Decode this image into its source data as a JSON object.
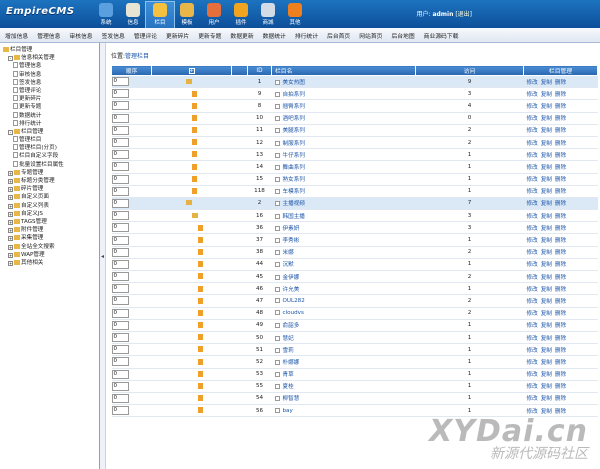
{
  "header": {
    "logo": "EmpireCMS",
    "nav": [
      {
        "label": "系统",
        "icon": "system-icon",
        "color": "#5aa0e0"
      },
      {
        "label": "信息",
        "icon": "info-icon",
        "color": "#e8e4d4"
      },
      {
        "label": "栏目",
        "icon": "column-icon",
        "color": "#f3c040",
        "active": true
      },
      {
        "label": "模板",
        "icon": "template-icon",
        "color": "#e9b64a"
      },
      {
        "label": "用户",
        "icon": "user-icon",
        "color": "#e66f3c"
      },
      {
        "label": "插件",
        "icon": "plugin-icon",
        "color": "#f0a41f"
      },
      {
        "label": "商城",
        "icon": "shop-icon",
        "color": "#d3dbe6"
      },
      {
        "label": "其他",
        "icon": "other-icon",
        "color": "#f07f1e"
      }
    ],
    "user_prefix": "用户:",
    "user_name": "admin",
    "logout": "[退出]"
  },
  "subnav": [
    "增加信息",
    "管理信息",
    "审核信息",
    "签发信息",
    "管理评论",
    "更新碎片",
    "更新专题",
    "数据更新",
    "数据统计",
    "排行统计",
    "后台首页",
    "网站首页",
    "后台地图",
    "商业源码下载"
  ],
  "tree": [
    {
      "lv": 0,
      "k": "fd",
      "t": "栏目管理"
    },
    {
      "lv": 1,
      "k": "fd",
      "t": "信息相关管理",
      "exp": "-"
    },
    {
      "lv": 2,
      "k": "doc",
      "t": "管理信息"
    },
    {
      "lv": 2,
      "k": "doc",
      "t": "审核信息"
    },
    {
      "lv": 2,
      "k": "doc",
      "t": "签发信息"
    },
    {
      "lv": 2,
      "k": "doc",
      "t": "管理评论"
    },
    {
      "lv": 2,
      "k": "doc",
      "t": "更新碎片"
    },
    {
      "lv": 2,
      "k": "doc",
      "t": "更新专题"
    },
    {
      "lv": 2,
      "k": "doc",
      "t": "数据统计"
    },
    {
      "lv": 2,
      "k": "doc",
      "t": "排行统计"
    },
    {
      "lv": 1,
      "k": "fd",
      "t": "栏目管理",
      "exp": "-"
    },
    {
      "lv": 2,
      "k": "doc",
      "t": "管理栏目"
    },
    {
      "lv": 2,
      "k": "doc",
      "t": "管理栏目(分页)"
    },
    {
      "lv": 2,
      "k": "doc",
      "t": "栏目自定义字段"
    },
    {
      "lv": 2,
      "k": "doc",
      "t": "批量设置栏目属性"
    },
    {
      "lv": 1,
      "k": "fd",
      "t": "专题管理",
      "exp": "+"
    },
    {
      "lv": 1,
      "k": "fd",
      "t": "标题分类管理",
      "exp": "+"
    },
    {
      "lv": 1,
      "k": "fd",
      "t": "碎片管理",
      "exp": "+"
    },
    {
      "lv": 1,
      "k": "fd",
      "t": "自定义页面",
      "exp": "+"
    },
    {
      "lv": 1,
      "k": "fd",
      "t": "自定义列表",
      "exp": "+"
    },
    {
      "lv": 1,
      "k": "fd",
      "t": "自定义JS",
      "exp": "+"
    },
    {
      "lv": 1,
      "k": "fd",
      "t": "TAGS管理",
      "exp": "+"
    },
    {
      "lv": 1,
      "k": "fd",
      "t": "附件管理",
      "exp": "+"
    },
    {
      "lv": 1,
      "k": "fd",
      "t": "采集管理",
      "exp": "+"
    },
    {
      "lv": 1,
      "k": "fd",
      "t": "全站全文搜索",
      "exp": "+"
    },
    {
      "lv": 1,
      "k": "fd",
      "t": "WAP管理",
      "exp": "+"
    },
    {
      "lv": 1,
      "k": "fd",
      "t": "其他相关",
      "exp": "+"
    }
  ],
  "breadcrumb": {
    "prefix": "位置:",
    "link": "管理栏目"
  },
  "table": {
    "headers": {
      "order": "顺序",
      "id": "ID",
      "name": "栏目名",
      "visits": "访问",
      "manage": "栏目管理"
    },
    "ops": [
      "修改",
      "复制",
      "删除"
    ],
    "rows": [
      {
        "order": "0",
        "lv": 0,
        "icon": "fold",
        "id": "1",
        "name": "美女热图",
        "visits": "9",
        "hl": true
      },
      {
        "order": "0",
        "lv": 1,
        "icon": "pg",
        "id": "9",
        "name": "自拍系列",
        "visits": "3"
      },
      {
        "order": "0",
        "lv": 1,
        "icon": "pg",
        "id": "8",
        "name": "翘臀系列",
        "visits": "4"
      },
      {
        "order": "0",
        "lv": 1,
        "icon": "pg",
        "id": "10",
        "name": "酒吧系列",
        "visits": "0"
      },
      {
        "order": "0",
        "lv": 1,
        "icon": "pg",
        "id": "11",
        "name": "美腿系列",
        "visits": "2"
      },
      {
        "order": "0",
        "lv": 1,
        "icon": "pg",
        "id": "12",
        "name": "制服系列",
        "visits": "2"
      },
      {
        "order": "0",
        "lv": 1,
        "icon": "pg",
        "id": "13",
        "name": "牛仔系列",
        "visits": "1"
      },
      {
        "order": "0",
        "lv": 1,
        "icon": "pg",
        "id": "14",
        "name": "舞曲系列",
        "visits": "1"
      },
      {
        "order": "0",
        "lv": 1,
        "icon": "pg",
        "id": "15",
        "name": "熟女系列",
        "visits": "1"
      },
      {
        "order": "0",
        "lv": 1,
        "icon": "pg",
        "id": "118",
        "name": "车模系列",
        "visits": "1"
      },
      {
        "order": "0",
        "lv": 0,
        "icon": "fold",
        "id": "2",
        "name": "主播视频",
        "visits": "7",
        "hl": true
      },
      {
        "order": "0",
        "lv": 1,
        "icon": "fold",
        "id": "16",
        "name": "韩国主播",
        "visits": "3"
      },
      {
        "order": "0",
        "lv": 2,
        "icon": "pg",
        "id": "36",
        "name": "伊素妍",
        "visits": "3"
      },
      {
        "order": "0",
        "lv": 2,
        "icon": "pg",
        "id": "37",
        "name": "李秀彬",
        "visits": "1"
      },
      {
        "order": "0",
        "lv": 2,
        "icon": "pg",
        "id": "38",
        "name": "米娜",
        "visits": "2"
      },
      {
        "order": "0",
        "lv": 2,
        "icon": "pg",
        "id": "44",
        "name": "沉默",
        "visits": "1"
      },
      {
        "order": "0",
        "lv": 2,
        "icon": "pg",
        "id": "45",
        "name": "金伊娜",
        "visits": "2"
      },
      {
        "order": "0",
        "lv": 2,
        "icon": "pg",
        "id": "46",
        "name": "许允美",
        "visits": "1"
      },
      {
        "order": "0",
        "lv": 2,
        "icon": "pg",
        "id": "47",
        "name": "OUL282",
        "visits": "2"
      },
      {
        "order": "0",
        "lv": 2,
        "icon": "pg",
        "id": "48",
        "name": "cloudvs",
        "visits": "2"
      },
      {
        "order": "0",
        "lv": 2,
        "icon": "pg",
        "id": "49",
        "name": "俞韶多",
        "visits": "1"
      },
      {
        "order": "0",
        "lv": 2,
        "icon": "pg",
        "id": "50",
        "name": "慧妃",
        "visits": "1"
      },
      {
        "order": "0",
        "lv": 2,
        "icon": "pg",
        "id": "51",
        "name": "雪莉",
        "visits": "1"
      },
      {
        "order": "0",
        "lv": 2,
        "icon": "pg",
        "id": "52",
        "name": "朴娜娜",
        "visits": "1"
      },
      {
        "order": "0",
        "lv": 2,
        "icon": "pg",
        "id": "53",
        "name": "青草",
        "visits": "1"
      },
      {
        "order": "0",
        "lv": 2,
        "icon": "pg",
        "id": "55",
        "name": "夏桂",
        "visits": "1"
      },
      {
        "order": "0",
        "lv": 2,
        "icon": "pg",
        "id": "54",
        "name": "柳智慧",
        "visits": "1"
      },
      {
        "order": "0",
        "lv": 2,
        "icon": "pg",
        "id": "56",
        "name": "bay",
        "visits": "1"
      }
    ]
  },
  "watermark": {
    "line1": "XYDai.cn",
    "line2": "新源代源码社区"
  }
}
